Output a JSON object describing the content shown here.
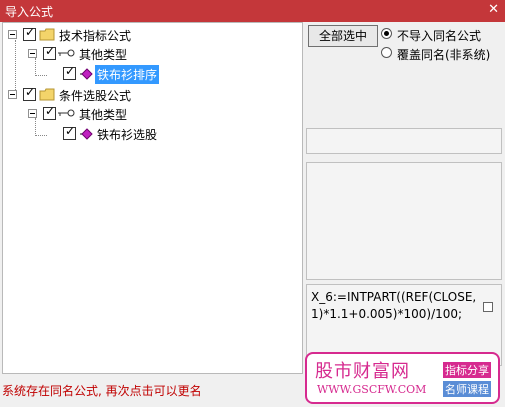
{
  "window": {
    "title": "导入公式",
    "close_glyph": "✕"
  },
  "tree": {
    "groups": [
      {
        "label": "技术指标公式",
        "child": {
          "label": "其他类型",
          "leaf": {
            "label": "铁布衫排序",
            "selected": true
          }
        }
      },
      {
        "label": "条件选股公式",
        "child": {
          "label": "其他类型",
          "leaf": {
            "label": "铁布衫选股",
            "selected": false
          }
        }
      }
    ]
  },
  "right": {
    "select_all_label": "全部选中",
    "radios": [
      {
        "label": "不导入同名公式",
        "checked": true
      },
      {
        "label": "覆盖同名(非系统)",
        "checked": false
      }
    ],
    "formula_text": "X_6:=INTPART((REF(CLOSE,1)*1.1+0.005)*100)/100;"
  },
  "status": {
    "message": "系统存在同名公式, 再次点击可以更名"
  },
  "watermark": {
    "title": "股市财富网",
    "url": "WWW.GSCFW.COM",
    "tag1": "指标分享",
    "tag2": "名师课程"
  },
  "colors": {
    "titlebar": "#c4373a",
    "selection": "#3399ff",
    "status": "#c00000",
    "brand": "#d62a8f"
  }
}
